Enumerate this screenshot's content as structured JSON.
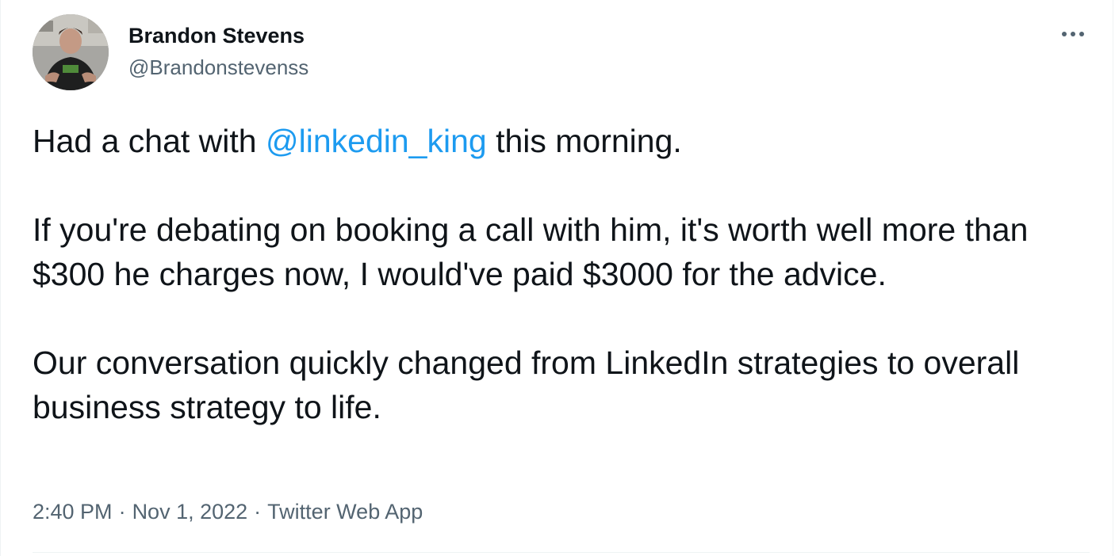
{
  "author": {
    "display_name": "Brandon Stevens",
    "handle": "@Brandonstevenss",
    "avatar_icon": "profile-photo"
  },
  "menu": {
    "more_icon": "more-horizontal-icon"
  },
  "tweet": {
    "line1_before": "Had a chat with ",
    "mention": "@linkedin_king",
    "line1_after": " this morning.",
    "paragraph2": "If you're debating on booking a call with him, it's worth well more than $300 he charges now, I would've paid $3000 for the advice.",
    "paragraph3": "Our conversation quickly changed from LinkedIn strategies to overall business strategy to life."
  },
  "meta": {
    "time": "2:40 PM",
    "date": "Nov 1, 2022",
    "source": "Twitter Web App",
    "separator": "·"
  },
  "colors": {
    "text": "#0f1419",
    "secondary": "#536471",
    "link": "#1d9bf0",
    "divider": "#eff3f4"
  }
}
